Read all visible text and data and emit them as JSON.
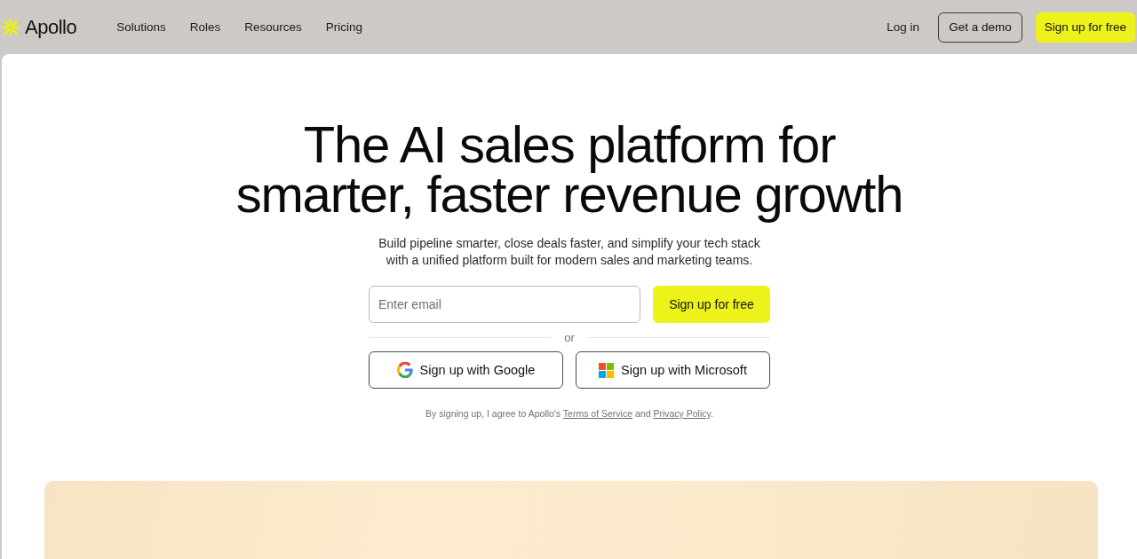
{
  "header": {
    "logo": {
      "text": "Apollo"
    },
    "nav": [
      {
        "label": "Solutions"
      },
      {
        "label": "Roles"
      },
      {
        "label": "Resources"
      },
      {
        "label": "Pricing"
      }
    ],
    "actions": [
      {
        "label": "Log in",
        "kind": "link"
      },
      {
        "label": "Get a demo",
        "kind": "outline"
      },
      {
        "label": "Sign up for free",
        "kind": "primary"
      }
    ]
  },
  "hero": {
    "title": "The AI sales platform for smarter, faster revenue growth",
    "subtitle": "Build pipeline smarter, close deals faster, and simplify your tech stack with a unified platform built for modern sales and marketing teams."
  },
  "signup": {
    "email": {
      "placeholder": "Enter email"
    },
    "submit": "Sign up for free",
    "divider": "or",
    "social": [
      {
        "label": "Sign up with Google",
        "kind": "google"
      },
      {
        "label": "Sign up with Microsoft",
        "kind": "microsoft"
      }
    ],
    "legal": {
      "before": "By signing up, I agree to Apollo's",
      "terms_link": "Terms of Service",
      "middle": "and",
      "privacy_link": "Privacy Policy",
      "end": "."
    }
  }
}
